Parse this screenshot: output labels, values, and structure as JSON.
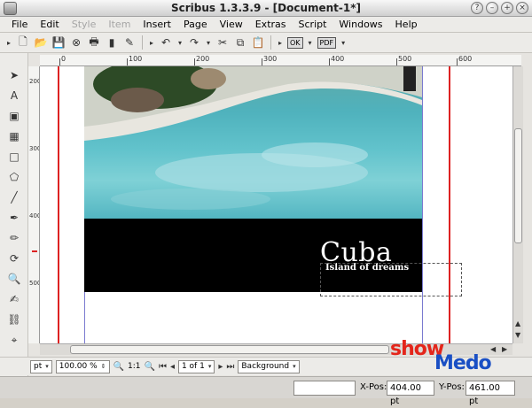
{
  "window": {
    "title": "Scribus 1.3.3.9 - [Document-1*]"
  },
  "menubar": {
    "items": [
      {
        "label": "File",
        "disabled": false
      },
      {
        "label": "Edit",
        "disabled": false
      },
      {
        "label": "Style",
        "disabled": true
      },
      {
        "label": "Item",
        "disabled": true
      },
      {
        "label": "Insert",
        "disabled": false
      },
      {
        "label": "Page",
        "disabled": false
      },
      {
        "label": "View",
        "disabled": false
      },
      {
        "label": "Extras",
        "disabled": false
      },
      {
        "label": "Script",
        "disabled": false
      },
      {
        "label": "Windows",
        "disabled": false
      },
      {
        "label": "Help",
        "disabled": false
      }
    ]
  },
  "toolbar": {
    "ok_label": "OK",
    "pdf_label": "PDF"
  },
  "ruler": {
    "h_labels": [
      "0",
      "100",
      "200",
      "300",
      "400",
      "500",
      "600"
    ],
    "v_labels": [
      "200",
      "300",
      "400",
      "500"
    ]
  },
  "document": {
    "title": "Cuba",
    "subtitle": "Island of dreams"
  },
  "statusbar": {
    "unit": "pt",
    "zoom": "100.00 %",
    "ratio": "1:1",
    "page": "1 of 1",
    "layer": "Background"
  },
  "bottombar": {
    "xpos_label": "X-Pos:",
    "xpos_value": "404.00 pt",
    "ypos_label": "Y-Pos:",
    "ypos_value": "461.00 pt"
  },
  "logo": {
    "show": "show",
    "medo": "Medo"
  },
  "colors": {
    "accent_red": "#e4261b",
    "accent_blue": "#1a4fc4",
    "guide_red": "#dd2222"
  }
}
